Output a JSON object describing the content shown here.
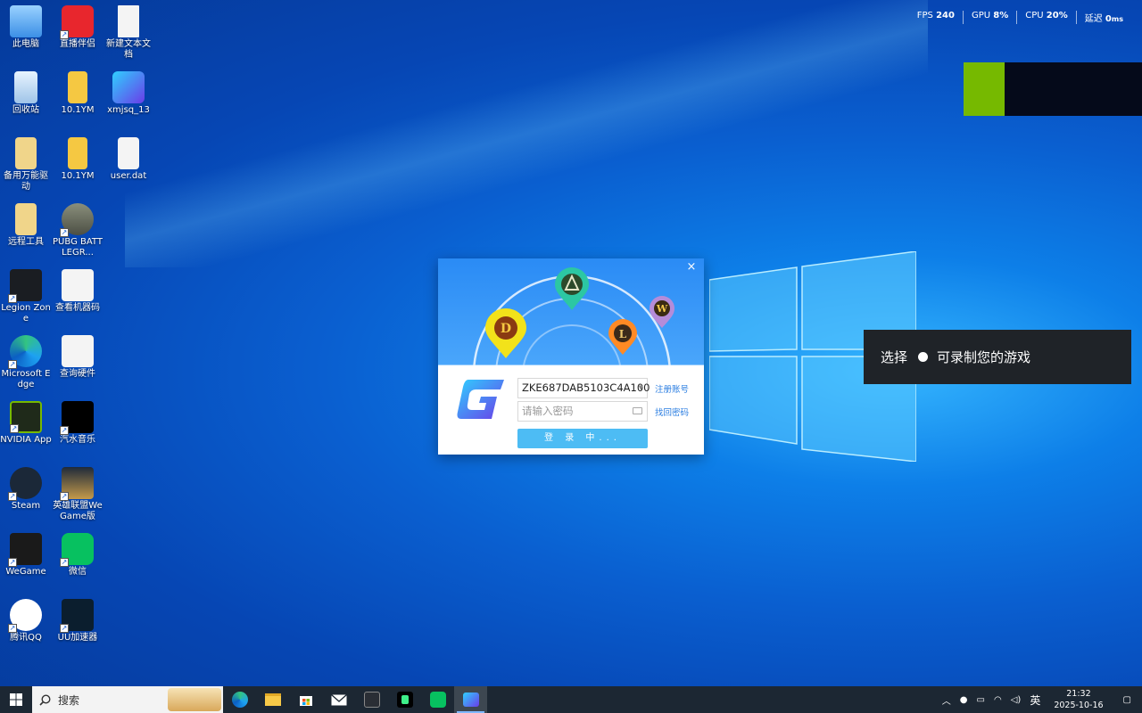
{
  "desktop": {
    "icons": [
      {
        "label": "此电脑"
      },
      {
        "label": "直播伴侣"
      },
      {
        "label": "新建文本文档"
      },
      {
        "label": "回收站"
      },
      {
        "label": "10.1YM"
      },
      {
        "label": "xmjsq_13"
      },
      {
        "label": "备用万能驱动"
      },
      {
        "label": "10.1YM"
      },
      {
        "label": "user.dat"
      },
      {
        "label": "远程工具"
      },
      {
        "label": "PUBG BATTLEGR..."
      },
      {
        "label": "Legion Zone"
      },
      {
        "label": "查看机器码"
      },
      {
        "label": "Microsoft Edge"
      },
      {
        "label": "查询硬件"
      },
      {
        "label": "NVIDIA App"
      },
      {
        "label": "汽水音乐"
      },
      {
        "label": "Steam"
      },
      {
        "label": "英雄联盟WeGame版"
      },
      {
        "label": "WeGame"
      },
      {
        "label": "微信"
      },
      {
        "label": "腾讯QQ"
      },
      {
        "label": "UU加速器"
      }
    ]
  },
  "perf_overlay": {
    "fps_label": "FPS",
    "fps_value": "240",
    "gpu_label": "GPU",
    "gpu_value": "8",
    "cpu_label": "CPU",
    "cpu_value": "20",
    "latency_label": "延迟",
    "latency_value": "0",
    "percent": "%",
    "ms": "ms"
  },
  "toast": {
    "prefix": "选择",
    "message": "可录制您的游戏"
  },
  "login_dialog": {
    "account_value": "ZKE687DAB5103C4A100",
    "password_placeholder": "请输入密码",
    "register_link": "注册账号",
    "recover_link": "找回密码",
    "login_button": "登 录 中...",
    "close_glyph": "×",
    "pins": [
      "D",
      "W",
      "L"
    ]
  },
  "taskbar": {
    "search_placeholder": "搜索",
    "apps": [
      "edge-icon",
      "file-explorer-icon",
      "store-icon",
      "mail-icon",
      "legion-icon",
      "music-icon",
      "wechat-icon",
      "xmjsq-icon"
    ],
    "tray": {
      "ime": "英",
      "time": "21:32",
      "date": "2025-10-16"
    }
  },
  "colors": {
    "accent": "#4dbcf4",
    "nvidia_green": "#76b900",
    "taskbar": "#1c2733"
  }
}
